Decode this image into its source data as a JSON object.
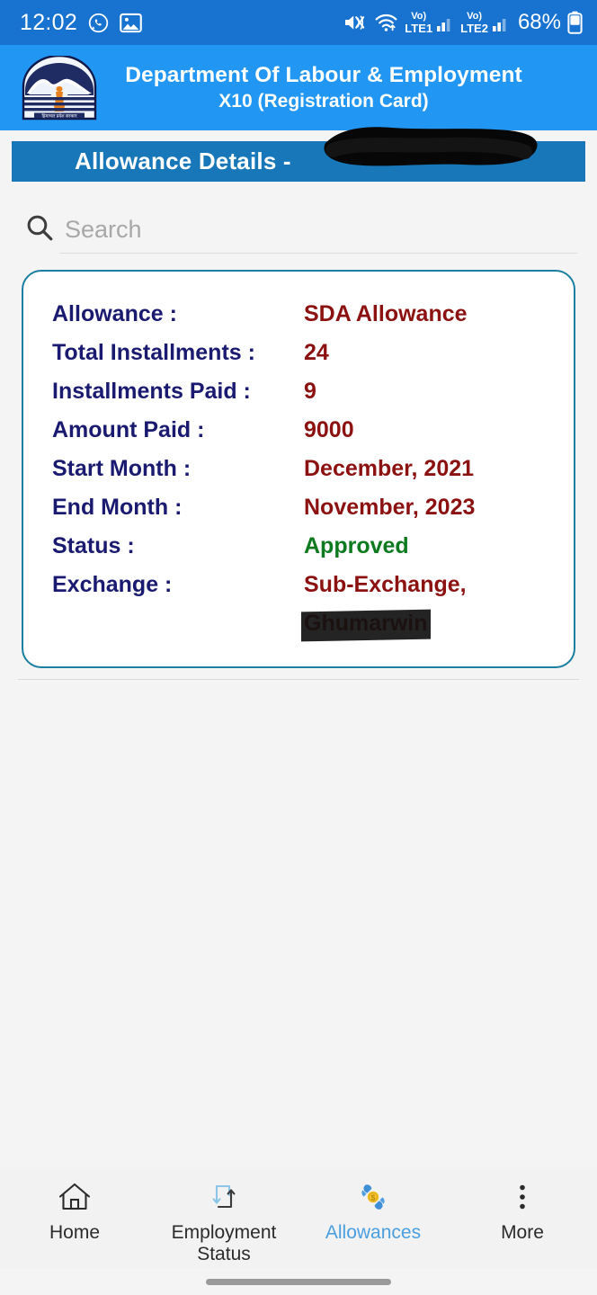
{
  "status_bar": {
    "time": "12:02",
    "battery_percent": "68%",
    "left_icons": [
      "whatsapp-icon",
      "gallery-icon"
    ],
    "right_icons": [
      "mute-icon",
      "wifi-icon",
      "volte1-signal-icon",
      "volte2-signal-icon",
      "battery-icon"
    ],
    "sim1_label": "LTE1",
    "sim2_label": "LTE2",
    "volte_label": "Vo)",
    "background": "#1872d0"
  },
  "header": {
    "title": "Department Of Labour & Employment",
    "subtitle": "X10 (Registration Card)",
    "emblem_name": "himachal-pradesh-government-emblem",
    "background": "#2196f3"
  },
  "page_title": {
    "text": "Allowance Details -",
    "redacted_suffix": "",
    "background": "#1777b8"
  },
  "search": {
    "placeholder": "Search",
    "value": "",
    "icon": "search-icon"
  },
  "card": {
    "border_color": "#1a7fa0",
    "label_color": "#1a1a70",
    "value_color": "#8c1111",
    "status_color": "#0d7a20",
    "rows": [
      {
        "label": "Allowance :",
        "value": "SDA Allowance"
      },
      {
        "label": "Total Installments :",
        "value": "24"
      },
      {
        "label": "Installments Paid :",
        "value": "9"
      },
      {
        "label": "Amount Paid :",
        "value": "9000"
      },
      {
        "label": "Start Month :",
        "value": "December, 2021"
      },
      {
        "label": "End Month :",
        "value": "November, 2023"
      },
      {
        "label": "Status :",
        "value": "Approved"
      },
      {
        "label": "Exchange :",
        "value": "Sub-Exchange,",
        "value_line2": "Ghumarwin"
      }
    ]
  },
  "bottom_nav": {
    "active_color": "#4a9fe0",
    "items": [
      {
        "label": "Home",
        "icon": "home-icon"
      },
      {
        "label": "Employment\nStatus",
        "icon": "exchange-arrows-icon"
      },
      {
        "label": "Allowances",
        "icon": "hands-coin-icon"
      },
      {
        "label": "More",
        "icon": "more-vertical-icon"
      }
    ]
  }
}
